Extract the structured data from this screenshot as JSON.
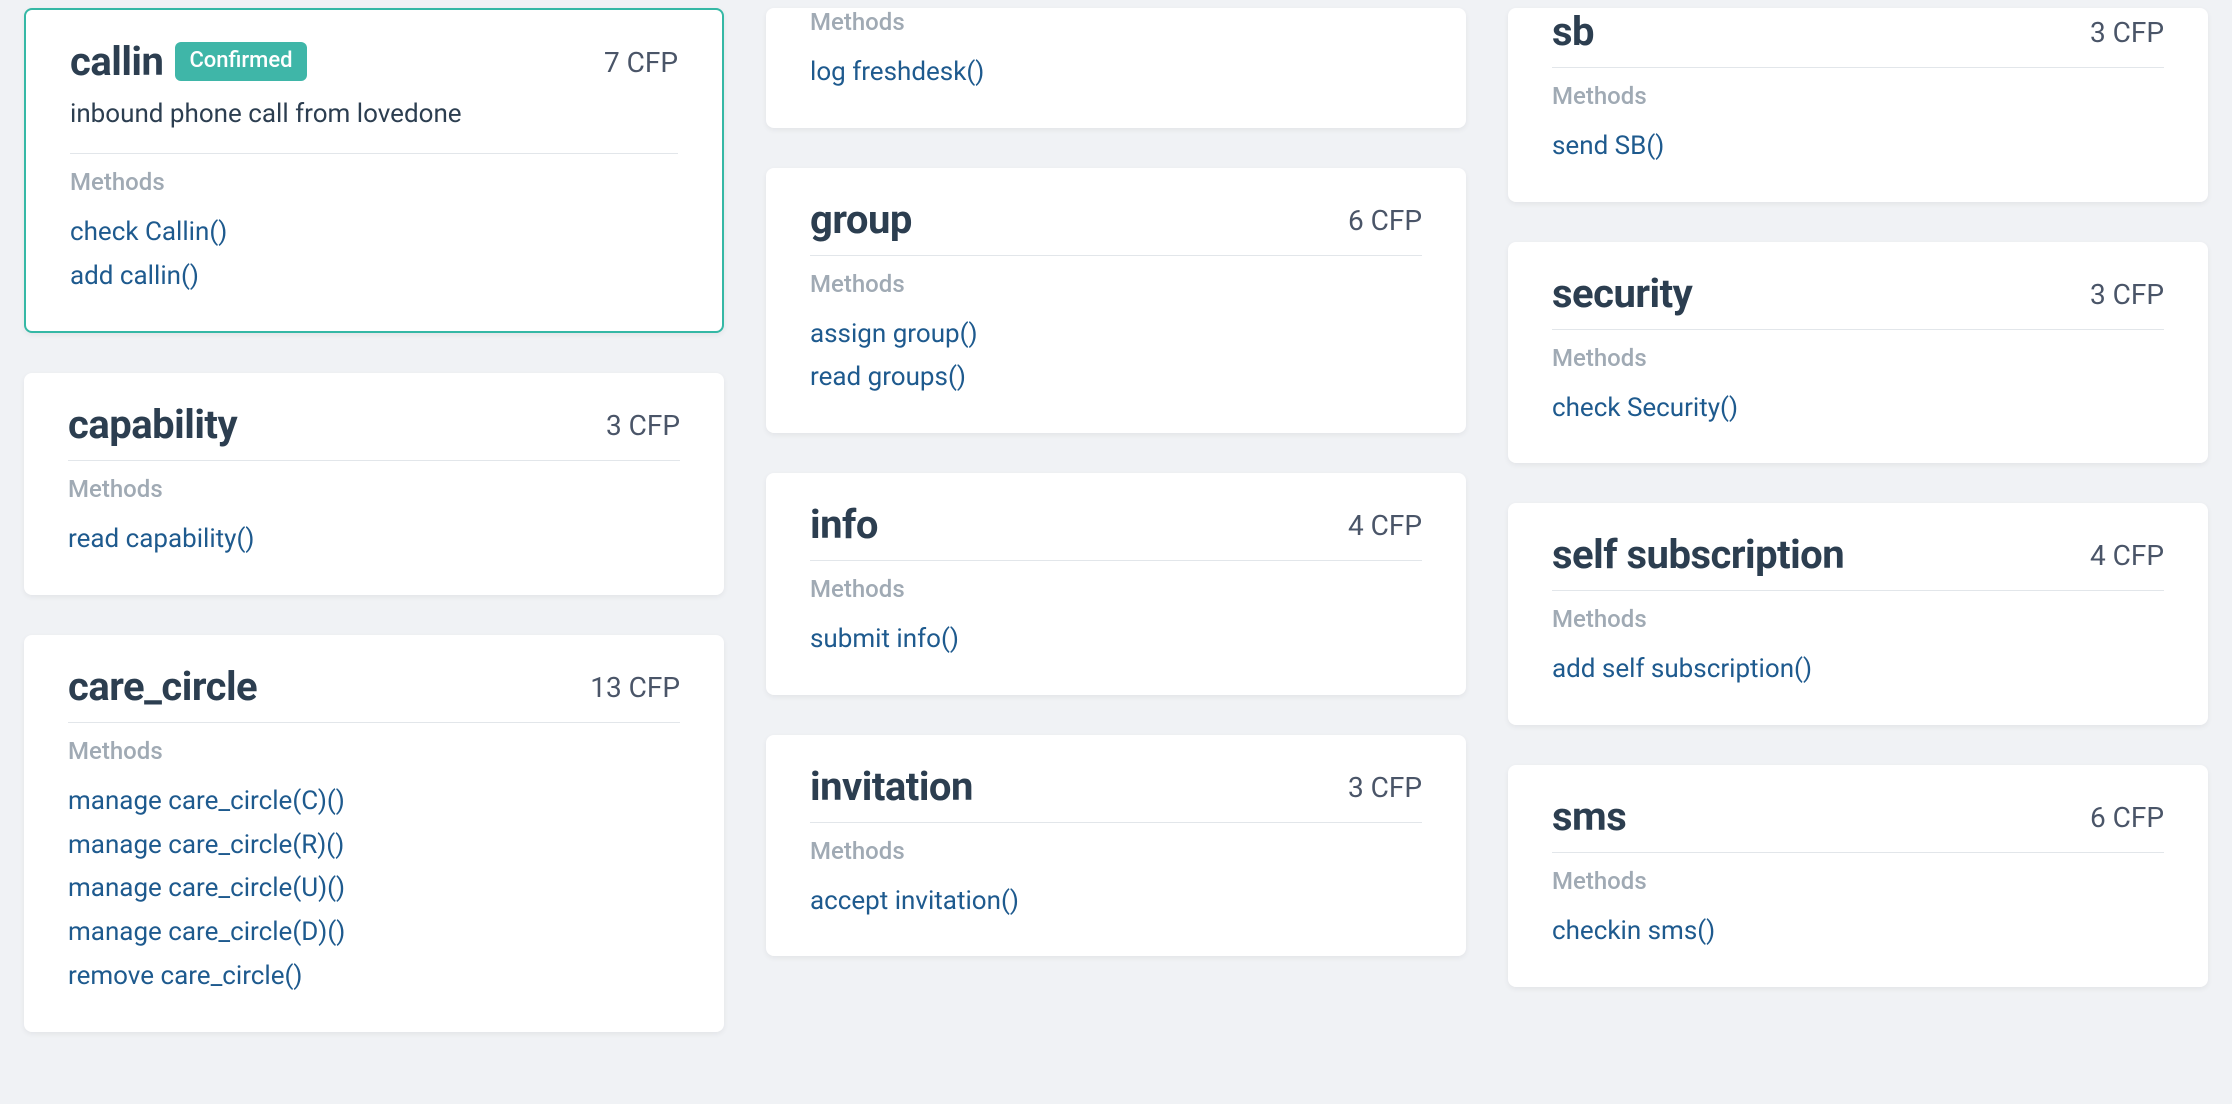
{
  "labels": {
    "methods": "Methods",
    "cfp_suffix": "CFP"
  },
  "columns": [
    [
      {
        "id": "callin",
        "title": "callin",
        "badge": "Confirmed",
        "cfp": 7,
        "description": "inbound phone call from lovedone",
        "selected": true,
        "methods": [
          "check Callin()",
          "add callin()"
        ]
      },
      {
        "id": "capability",
        "title": "capability",
        "cfp": 3,
        "methods": [
          "read capability()"
        ]
      },
      {
        "id": "care_circle",
        "title": "care_circle",
        "cfp": 13,
        "methods": [
          "manage care_circle(C)()",
          "manage care_circle(R)()",
          "manage care_circle(U)()",
          "manage care_circle(D)()",
          "remove care_circle()"
        ]
      }
    ],
    [
      {
        "id": "freshdesk",
        "partial_top": true,
        "methods": [
          "log freshdesk()"
        ]
      },
      {
        "id": "group",
        "title": "group",
        "cfp": 6,
        "methods": [
          "assign group()",
          "read groups()"
        ]
      },
      {
        "id": "info",
        "title": "info",
        "cfp": 4,
        "methods": [
          "submit info()"
        ]
      },
      {
        "id": "invitation",
        "title": "invitation",
        "cfp": 3,
        "methods": [
          "accept invitation()"
        ]
      }
    ],
    [
      {
        "id": "sb",
        "title": "sb",
        "cfp": 3,
        "tight_top": true,
        "methods": [
          "send SB()"
        ]
      },
      {
        "id": "security",
        "title": "security",
        "cfp": 3,
        "methods": [
          "check Security()"
        ]
      },
      {
        "id": "self_subscription",
        "title": "self subscription",
        "cfp": 4,
        "methods": [
          "add self subscription()"
        ]
      },
      {
        "id": "sms",
        "title": "sms",
        "cfp": 6,
        "methods": [
          "checkin sms()"
        ]
      }
    ]
  ]
}
